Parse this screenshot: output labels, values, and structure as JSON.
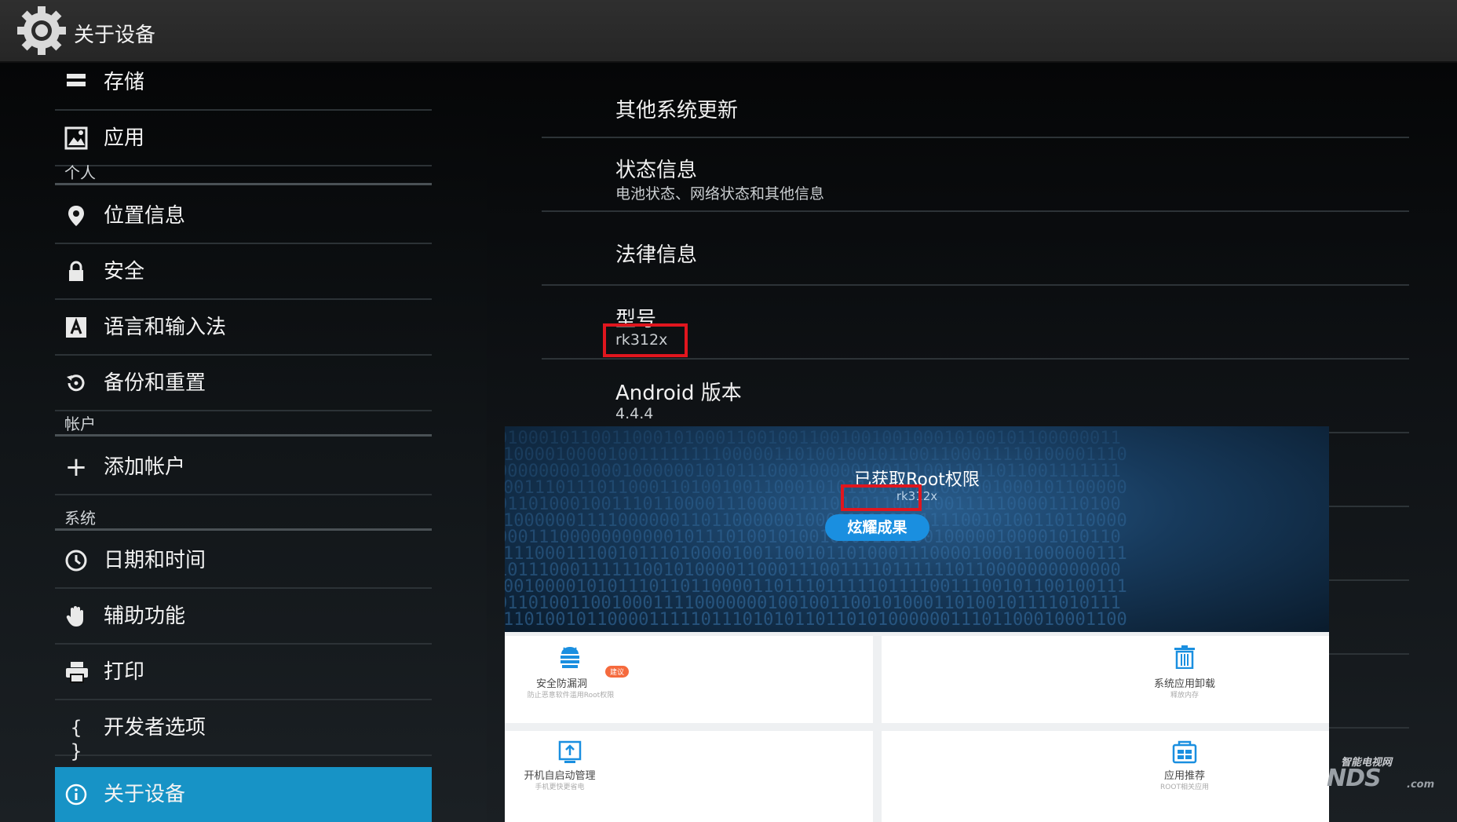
{
  "actionbar": {
    "title": "关于设备",
    "icon": "gear-icon"
  },
  "sidebar": {
    "items": [
      {
        "label": "存储",
        "icon": "storage-icon"
      },
      {
        "label": "应用",
        "icon": "apps-icon"
      },
      {
        "header": "个人"
      },
      {
        "label": "位置信息",
        "icon": "location-pin-icon"
      },
      {
        "label": "安全",
        "icon": "lock-icon"
      },
      {
        "label": "语言和输入法",
        "icon": "keyboard-a-icon"
      },
      {
        "label": "备份和重置",
        "icon": "backup-restore-icon"
      },
      {
        "header": "帐户"
      },
      {
        "label": "添加帐户",
        "icon": "plus-icon"
      },
      {
        "header": "系统"
      },
      {
        "label": "日期和时间",
        "icon": "clock-icon"
      },
      {
        "label": "辅助功能",
        "icon": "hand-icon"
      },
      {
        "label": "打印",
        "icon": "printer-icon"
      },
      {
        "label": "开发者选项",
        "icon": "braces-icon"
      },
      {
        "label": "关于设备",
        "icon": "info-icon",
        "selected": true
      }
    ],
    "braces_glyph": "{ }",
    "plus_glyph": "+"
  },
  "details": [
    {
      "title": "其他系统更新"
    },
    {
      "title": "状态信息",
      "summary": "电池状态、网络状态和其他信息"
    },
    {
      "title": "法律信息"
    },
    {
      "title": "型号",
      "summary": "rk312x"
    },
    {
      "title": "Android 版本",
      "summary": "4.4.4"
    }
  ],
  "overlay": {
    "root_title": "已获取Root权限",
    "model": "rk312x",
    "show_button": "炫耀成果",
    "cards": [
      {
        "title": "安全防漏洞",
        "subtitle": "防止恶意软件滥用Root权限",
        "badge": "建议",
        "icon": "android-bug-icon"
      },
      {
        "title": "系统应用卸载",
        "subtitle": "释放内存",
        "icon": "trash-icon"
      },
      {
        "title": "开机自启动管理",
        "subtitle": "手机更快更省电",
        "icon": "startup-icon"
      },
      {
        "title": "应用推荐",
        "subtitle": "ROOT相关应用",
        "icon": "app-recommend-icon"
      }
    ]
  },
  "watermark": {
    "line1": "智能电视网",
    "line2": "NDS",
    "line3": ".com"
  },
  "colors": {
    "accent": "#1793c6",
    "button": "#1a8fe0",
    "highlight_box": "#e0161e"
  }
}
